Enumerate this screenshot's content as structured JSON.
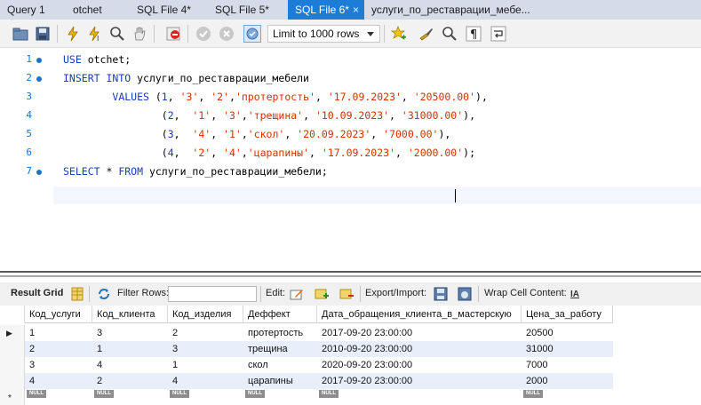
{
  "tabs": [
    {
      "label": "Query 1"
    },
    {
      "label": "otchet"
    },
    {
      "label": "SQL File 4*"
    },
    {
      "label": "SQL File 5*"
    },
    {
      "label": "SQL File 6*",
      "active": true,
      "close": "×"
    },
    {
      "label": "услуги_по_реставрации_мебе..."
    }
  ],
  "toolbar": {
    "limit_select": "Limit to 1000 rows"
  },
  "editor": {
    "lines": [
      {
        "n": "1",
        "code": [
          {
            "t": "kw",
            "s": "USE"
          },
          {
            "t": "p",
            "s": " otchet;"
          }
        ]
      },
      {
        "n": "2",
        "code": [
          {
            "t": "kw",
            "s": "INSERT INTO"
          },
          {
            "t": "p",
            "s": " услуги_по_реставрации_мебели"
          }
        ]
      },
      {
        "n": "3",
        "code": [
          {
            "t": "p",
            "s": "        "
          },
          {
            "t": "kw",
            "s": "VALUES"
          },
          {
            "t": "p",
            "s": " ("
          },
          {
            "t": "num",
            "s": "1"
          },
          {
            "t": "p",
            "s": ", "
          },
          {
            "t": "str",
            "s": "'3'"
          },
          {
            "t": "p",
            "s": ", "
          },
          {
            "t": "str",
            "s": "'2'"
          },
          {
            "t": "p",
            "s": ","
          },
          {
            "t": "str",
            "s": "'протертость'"
          },
          {
            "t": "p",
            "s": ", "
          },
          {
            "t": "str",
            "s": "'17.09.2023'"
          },
          {
            "t": "p",
            "s": ", "
          },
          {
            "t": "str",
            "s": "'20500.00'"
          },
          {
            "t": "p",
            "s": "),"
          }
        ]
      },
      {
        "n": "4",
        "code": [
          {
            "t": "p",
            "s": "                ("
          },
          {
            "t": "num",
            "s": "2"
          },
          {
            "t": "p",
            "s": ",  "
          },
          {
            "t": "str",
            "s": "'1'"
          },
          {
            "t": "p",
            "s": ", "
          },
          {
            "t": "str",
            "s": "'3'"
          },
          {
            "t": "p",
            "s": ","
          },
          {
            "t": "str",
            "s": "'трещина'"
          },
          {
            "t": "p",
            "s": ", "
          },
          {
            "t": "str",
            "s": "'10.09.2023'"
          },
          {
            "t": "p",
            "s": ", "
          },
          {
            "t": "str",
            "s": "'31000.00'"
          },
          {
            "t": "p",
            "s": "),"
          }
        ]
      },
      {
        "n": "5",
        "code": [
          {
            "t": "p",
            "s": "                ("
          },
          {
            "t": "num",
            "s": "3"
          },
          {
            "t": "p",
            "s": ",  "
          },
          {
            "t": "str",
            "s": "'4'"
          },
          {
            "t": "p",
            "s": ", "
          },
          {
            "t": "str",
            "s": "'1'"
          },
          {
            "t": "p",
            "s": ","
          },
          {
            "t": "str",
            "s": "'скол'"
          },
          {
            "t": "p",
            "s": ", "
          },
          {
            "t": "str",
            "s": "'20.09.2023'"
          },
          {
            "t": "p",
            "s": ", "
          },
          {
            "t": "str",
            "s": "'7000.00'"
          },
          {
            "t": "p",
            "s": "),"
          }
        ]
      },
      {
        "n": "6",
        "code": [
          {
            "t": "p",
            "s": "                ("
          },
          {
            "t": "num",
            "s": "4"
          },
          {
            "t": "p",
            "s": ",  "
          },
          {
            "t": "str",
            "s": "'2'"
          },
          {
            "t": "p",
            "s": ", "
          },
          {
            "t": "str",
            "s": "'4'"
          },
          {
            "t": "p",
            "s": ","
          },
          {
            "t": "str",
            "s": "'царапины'"
          },
          {
            "t": "p",
            "s": ", "
          },
          {
            "t": "str",
            "s": "'17.09.2023'"
          },
          {
            "t": "p",
            "s": ", "
          },
          {
            "t": "str",
            "s": "'2000.00'"
          },
          {
            "t": "p",
            "s": ");"
          }
        ]
      },
      {
        "n": "7",
        "code": [
          {
            "t": "kw",
            "s": "SELECT"
          },
          {
            "t": "p",
            "s": " * "
          },
          {
            "t": "kw",
            "s": "FROM"
          },
          {
            "t": "p",
            "s": " услуги_по_реставрации_мебели;"
          }
        ]
      }
    ]
  },
  "result_toolbar": {
    "result_grid": "Result Grid",
    "filter_rows": "Filter Rows:",
    "edit": "Edit:",
    "export_import": "Export/Import:",
    "wrap_cell": "Wrap Cell Content:",
    "wrap_icon_text": "IA"
  },
  "grid": {
    "columns": [
      "Код_услуги",
      "Код_клиента",
      "Код_изделия",
      "Деффект",
      "Дата_обращения_клиента_в_мастерскую",
      "Цена_за_работу"
    ],
    "rows": [
      [
        "1",
        "3",
        "2",
        "протертость",
        "2017-09-20 23:00:00",
        "20500"
      ],
      [
        "2",
        "1",
        "3",
        "трещина",
        "2010-09-20 23:00:00",
        "31000"
      ],
      [
        "3",
        "4",
        "1",
        "скол",
        "2020-09-20 23:00:00",
        "7000"
      ],
      [
        "4",
        "2",
        "4",
        "царапины",
        "2017-09-20 23:00:00",
        "2000"
      ]
    ],
    "null_label": "NULL",
    "new_row_marker": "*",
    "current_row_marker": "▶"
  },
  "colors": {
    "active_tab": "#1c7cd6",
    "keyword": "#1a3db8",
    "string": "#cc3300"
  }
}
